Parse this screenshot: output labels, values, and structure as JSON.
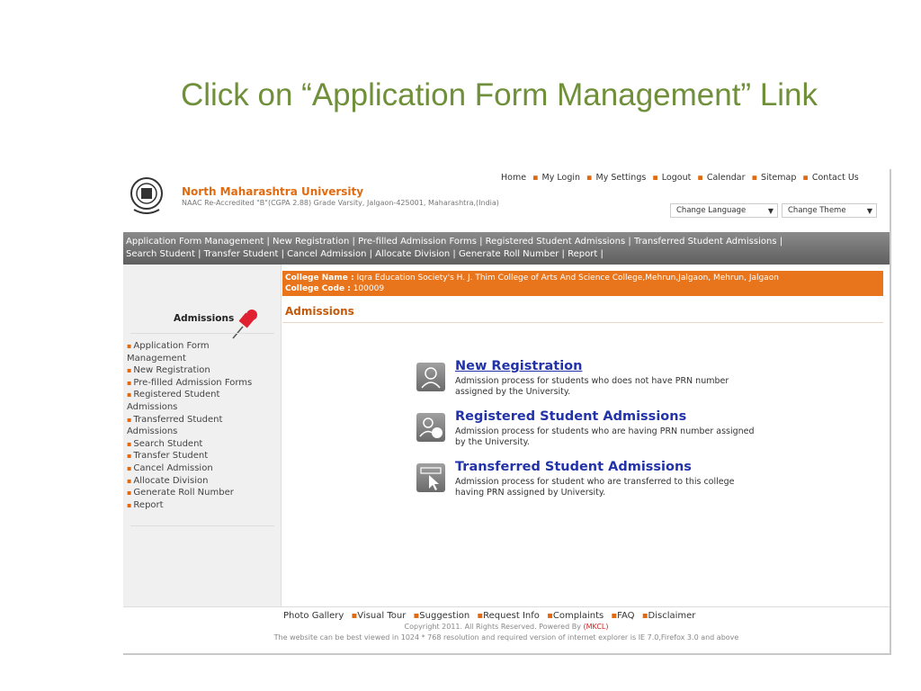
{
  "slide_title": "Click on “Application Form Management” Link",
  "header": {
    "university_name": "North Maharashtra University",
    "subtitle": "NAAC Re-Accredited \"B\"(CGPA 2.88) Grade Varsity, Jalgaon-425001, Maharashtra,(India)",
    "top_links": [
      "Home",
      "My Login",
      "My Settings",
      "Logout",
      "Calendar",
      "Sitemap",
      "Contact Us"
    ],
    "change_language": "Change Language",
    "change_theme": "Change Theme"
  },
  "navbar": {
    "items": [
      "Application Form Management",
      "New Registration",
      "Pre-filled Admission Forms",
      "Registered Student Admissions",
      "Transferred Student Admissions",
      "Search Student",
      "Transfer Student",
      "Cancel Admission",
      "Allocate Division",
      "Generate Roll Number",
      "Report"
    ],
    "separator": "|"
  },
  "sidebar": {
    "title": "Admissions",
    "items": [
      "Application Form Management",
      "New Registration",
      "Pre-filled Admission Forms",
      "Registered Student Admissions",
      "Transferred Student Admissions",
      "Search Student",
      "Transfer Student",
      "Cancel Admission",
      "Allocate Division",
      "Generate Roll Number",
      "Report"
    ]
  },
  "college": {
    "name_label": "College Name :",
    "name_value": "Iqra Education Society's H. J. Thim College of Arts And Science College,Mehrun,Jalgaon, Mehrun, Jalgaon",
    "code_label": "College Code :",
    "code_value": "100009"
  },
  "main": {
    "heading": "Admissions",
    "items": [
      {
        "title": "New Registration",
        "desc": "Admission process for students who does not have PRN number assigned by the University."
      },
      {
        "title": "Registered Student Admissions",
        "desc": "Admission process for students who are having PRN number assigned by the University."
      },
      {
        "title": "Transferred Student Admissions",
        "desc": "Admission process for student who are transferred to this college having PRN assigned by University."
      }
    ]
  },
  "footer": {
    "links": [
      "Photo Gallery",
      "Visual Tour",
      "Suggestion",
      "Request Info",
      "Complaints",
      "FAQ",
      "Disclaimer"
    ],
    "copyright": "Copyright 2011. All Rights Reserved. Powered By",
    "powered": "(MKCL)",
    "resolution_note": "The website can be best viewed in 1024 * 768 resolution and required version of internet explorer is IE 7.0,Firefox 3.0 and above"
  },
  "colors": {
    "accent": "#e8741c",
    "link": "#2233aa",
    "title_green": "#6f8f3a"
  }
}
